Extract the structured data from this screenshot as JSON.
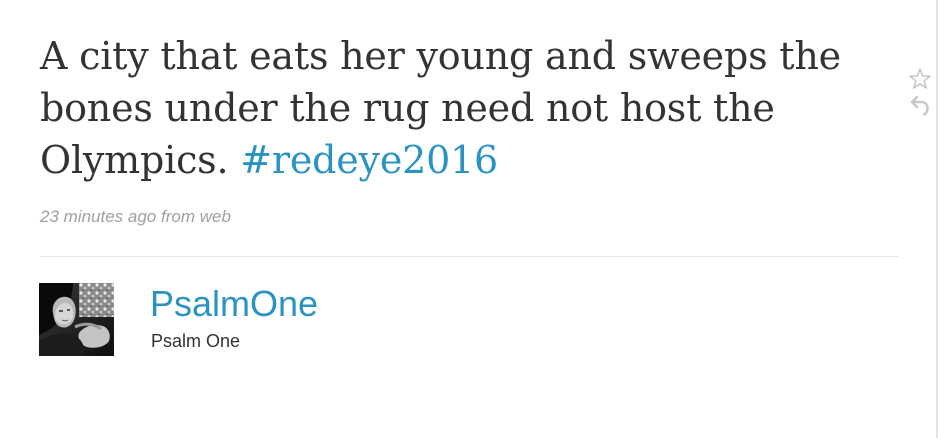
{
  "tweet": {
    "text": "A city that eats her young and sweeps the bones under the rug need not host the Olympics.",
    "hashtag": "#redeye2016",
    "timestamp": "23 minutes ago",
    "source_prefix": "from",
    "source": "web"
  },
  "author": {
    "screen_name": "PsalmOne",
    "full_name": "Psalm One"
  },
  "actions": {
    "favorite_icon": "star-outline-icon",
    "reply_icon": "reply-arrow-icon"
  },
  "colors": {
    "link": "#2b93c2",
    "text": "#333333",
    "meta": "#a0a0a0",
    "divider": "#e6e6e6"
  }
}
